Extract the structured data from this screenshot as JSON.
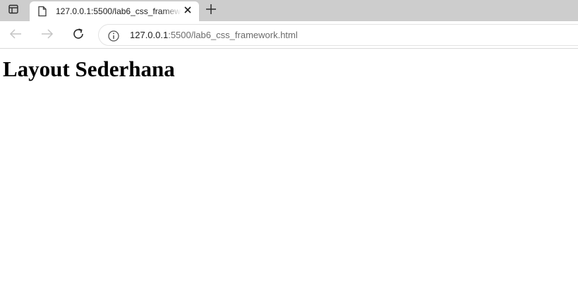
{
  "browser": {
    "tab": {
      "title": "127.0.0.1:5500/lab6_css_framework.html",
      "icons": {
        "favicon": "page-icon",
        "close": "close-icon"
      }
    },
    "new_tab_icon": "plus-icon",
    "tab_actions_icon": "tab-actions-icon",
    "toolbar": {
      "back_icon": "arrow-left-icon",
      "forward_icon": "arrow-right-icon",
      "reload_icon": "reload-icon",
      "info_icon": "info-icon"
    },
    "address_bar": {
      "host": "127.0.0.1",
      "rest": ":5500/lab6_css_framework.html"
    },
    "colors": {
      "tabstrip": "#cdcdcd",
      "toolbar": "#ffffff",
      "disabled_icon": "#b8b8b8",
      "icon": "#3b3b3b"
    }
  },
  "page": {
    "heading": "Layout Sederhana"
  }
}
